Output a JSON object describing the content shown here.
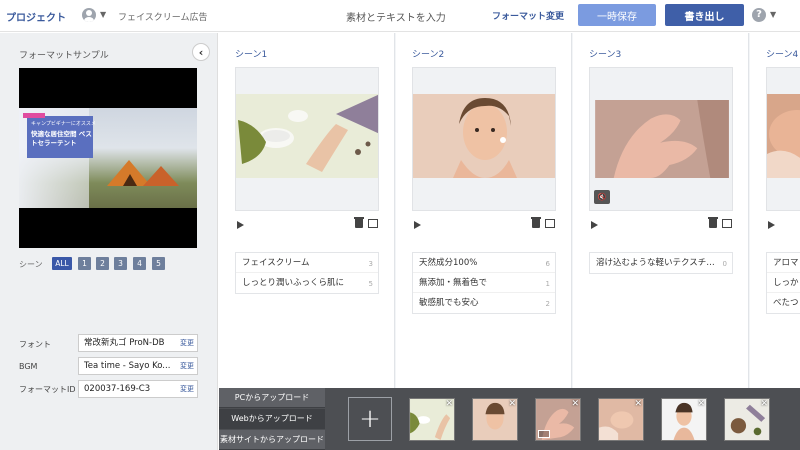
{
  "header": {
    "project_label": "プロジェクト",
    "project_name": "フェイスクリーム広告",
    "center_title": "素材とテキストを入力",
    "format_change": "フォーマット変更",
    "save_label": "一時保存",
    "export_label": "書き出し",
    "help_glyph": "?",
    "caret_glyph": "▼"
  },
  "sidebar": {
    "title": "フォーマットサンプル",
    "collapse_glyph": "‹",
    "video": {
      "small_text": "キャンプビギナーにオススメ",
      "main_text": "快適な居住空間 ベストセラーテント",
      "progress": 0.35
    },
    "scene_label": "シーン",
    "scene_buttons": [
      "ALL",
      "1",
      "2",
      "3",
      "4",
      "5"
    ],
    "settings": [
      {
        "label": "フォント",
        "value": "常改新丸ゴ ProN-DB",
        "change": "変更"
      },
      {
        "label": "BGM",
        "value": "Tea time - Sayo Ko...",
        "change": "変更"
      },
      {
        "label": "フォーマットID",
        "value": "020037-169-C3",
        "change": "変更"
      }
    ]
  },
  "scenes": [
    {
      "title": "シーン1",
      "texts": [
        {
          "text": "フェイスクリーム",
          "num": "3"
        },
        {
          "text": "しっとり潤いふっくら肌に",
          "num": "5"
        }
      ]
    },
    {
      "title": "シーン2",
      "texts": [
        {
          "text": "天然成分100%",
          "num": "6"
        },
        {
          "text": "無添加・無着色で",
          "num": "1"
        },
        {
          "text": "敏感肌でも安心",
          "num": "2"
        }
      ]
    },
    {
      "title": "シーン3",
      "texts": [
        {
          "text": "溶け込むような軽いテクスチ…",
          "num": "0"
        }
      ]
    },
    {
      "title": "シーン4",
      "texts": [
        {
          "text": "アロマ",
          "num": ""
        },
        {
          "text": "しっか",
          "num": ""
        },
        {
          "text": "べたつ",
          "num": ""
        }
      ]
    }
  ],
  "upload": {
    "buttons": [
      "PCからアップロード",
      "Webからアップロード",
      "素材サイトからアップロード"
    ],
    "active_index": 1,
    "plus_glyph": "+",
    "close_glyph": "✕"
  },
  "mute_glyph": "🔇"
}
